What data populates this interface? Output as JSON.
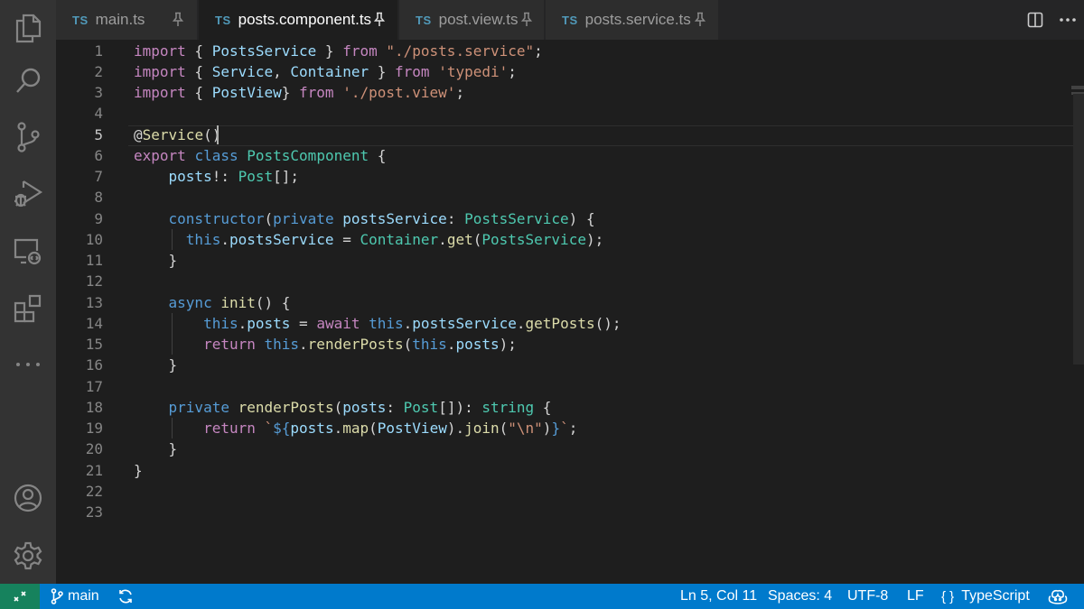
{
  "tabs": [
    {
      "badge": "TS",
      "name": "main.ts",
      "active": false
    },
    {
      "badge": "TS",
      "name": "posts.component.ts",
      "active": true
    },
    {
      "badge": "TS",
      "name": "post.view.ts",
      "active": false
    },
    {
      "badge": "TS",
      "name": "posts.service.ts",
      "active": false
    }
  ],
  "activity_bar": {
    "icons": [
      "explorer-icon",
      "search-icon",
      "source-control-icon",
      "run-debug-icon",
      "remote-explorer-icon",
      "extensions-icon",
      "more-icon",
      "account-icon",
      "settings-gear-icon"
    ]
  },
  "editor": {
    "line_numbers": [
      "1",
      "2",
      "3",
      "4",
      "5",
      "6",
      "7",
      "8",
      "9",
      "10",
      "11",
      "12",
      "13",
      "14",
      "15",
      "16",
      "17",
      "18",
      "19",
      "20",
      "21",
      "22",
      "23"
    ],
    "current_line": "5"
  },
  "status_bar": {
    "branch": "main",
    "position": "Ln 5, Col 11",
    "spaces": "Spaces: 4",
    "encoding": "UTF-8",
    "eol": "LF",
    "language_brace": "{ }",
    "language": "TypeScript"
  },
  "colors": {
    "status_bar": "#007acc",
    "remote": "#16825d",
    "editor_bg": "#1e1e1e",
    "activity_bar": "#333333"
  }
}
